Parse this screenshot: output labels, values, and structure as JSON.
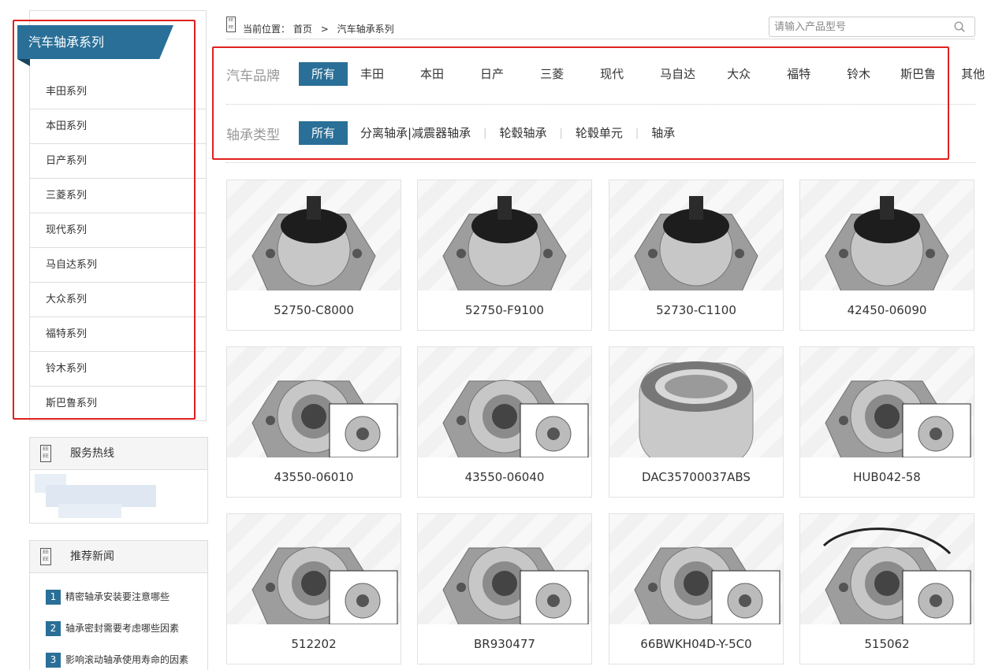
{
  "sidebar": {
    "category_title": "汽车轴承系列",
    "categories": [
      "丰田系列",
      "本田系列",
      "日产系列",
      "三菱系列",
      "现代系列",
      "马自达系列",
      "大众系列",
      "福特系列",
      "铃木系列",
      "斯巴鲁系列"
    ],
    "hotline_title": "服务热线",
    "news_title": "推荐新闻",
    "news": [
      {
        "num": "1",
        "title": "精密轴承安装要注意哪些"
      },
      {
        "num": "2",
        "title": "轴承密封需要考虑哪些因素"
      },
      {
        "num": "3",
        "title": "影响滚动轴承使用寿命的因素"
      }
    ]
  },
  "breadcrumb": {
    "prefix": "当前位置：",
    "home": "首页",
    "separator": ">",
    "current": "汽车轴承系列"
  },
  "search": {
    "placeholder": "请输入产品型号"
  },
  "filters": {
    "brand": {
      "label": "汽车品牌",
      "options": [
        "所有",
        "丰田",
        "本田",
        "日产",
        "三菱",
        "现代",
        "马自达",
        "大众",
        "福特",
        "铃木",
        "斯巴鲁",
        "其他"
      ],
      "selected": "所有"
    },
    "type": {
      "label": "轴承类型",
      "options": [
        "所有",
        "分离轴承|减震器轴承",
        "轮毂轴承",
        "轮毂单元",
        "轴承"
      ],
      "selected": "所有"
    }
  },
  "products": [
    {
      "name": "52750-C8000",
      "icon": "hub-unit-sensor-icon"
    },
    {
      "name": "52750-F9100",
      "icon": "hub-unit-sensor-icon"
    },
    {
      "name": "52730-C1100",
      "icon": "hub-unit-sensor-icon"
    },
    {
      "name": "42450-06090",
      "icon": "hub-unit-sensor-icon"
    },
    {
      "name": "43550-06010",
      "icon": "hub-unit-flange-icon"
    },
    {
      "name": "43550-06040",
      "icon": "hub-unit-flange-icon"
    },
    {
      "name": "DAC35700037ABS",
      "icon": "wheel-bearing-icon"
    },
    {
      "name": "HUB042-58",
      "icon": "hub-assembly-icon"
    },
    {
      "name": "512202",
      "icon": "hub-assembly-icon"
    },
    {
      "name": "BR930477",
      "icon": "hub-assembly-icon"
    },
    {
      "name": "66BWKH04D-Y-5C0",
      "icon": "hub-assembly-icon"
    },
    {
      "name": "515062",
      "icon": "hub-assembly-sensor-icon"
    }
  ],
  "colors": {
    "accent": "#2a6f97",
    "highlight_border": "#e02020"
  }
}
